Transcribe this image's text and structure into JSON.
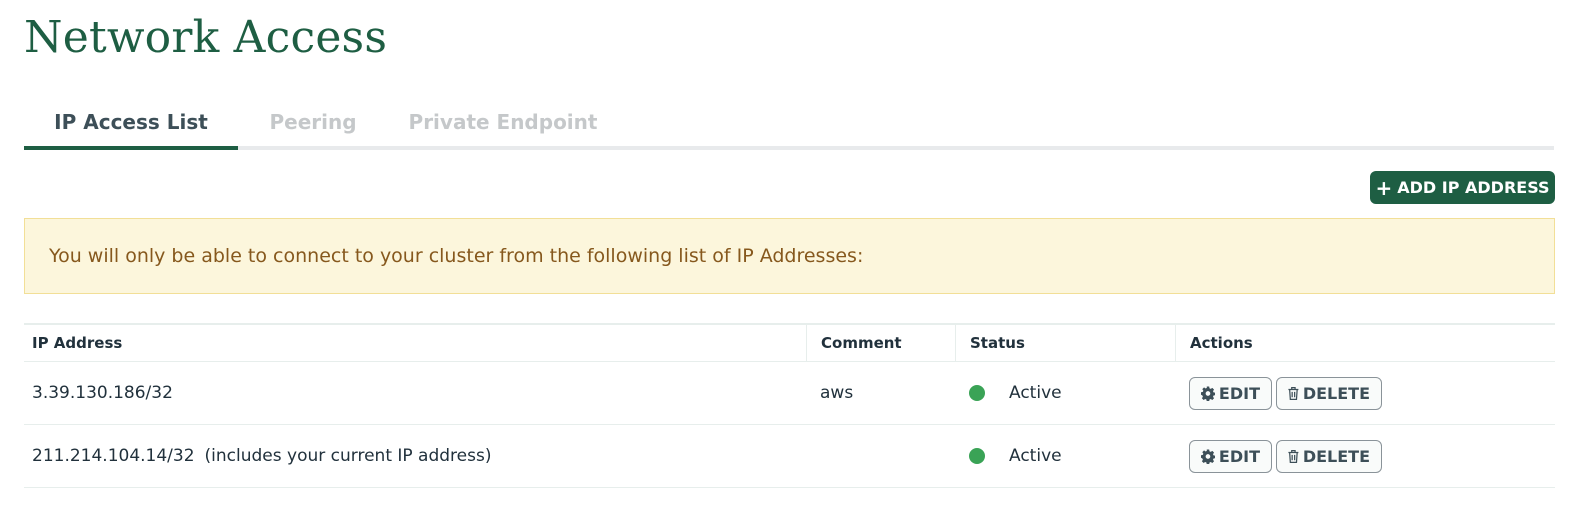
{
  "page": {
    "title": "Network Access"
  },
  "tabs": [
    {
      "label": "IP Access List",
      "active": true
    },
    {
      "label": "Peering",
      "active": false
    },
    {
      "label": "Private Endpoint",
      "active": false
    }
  ],
  "toolbar": {
    "add_label": "ADD IP ADDRESS",
    "add_icon": "plus-icon"
  },
  "banner": {
    "text": "You will only be able to connect to your cluster from the following list of IP Addresses:"
  },
  "table": {
    "headers": [
      "IP Address",
      "Comment",
      "Status",
      "Actions"
    ],
    "rows": [
      {
        "ip": "3.39.130.186/32",
        "note": "",
        "comment": "aws",
        "status": "Active",
        "edit_label": "EDIT",
        "delete_label": "DELETE"
      },
      {
        "ip": "211.214.104.14/32",
        "note": "(includes your current IP address)",
        "comment": "",
        "status": "Active",
        "edit_label": "EDIT",
        "delete_label": "DELETE"
      }
    ]
  },
  "colors": {
    "brand": "#1e5e43",
    "active_status": "#3aa356",
    "banner_bg": "#fcf6dc",
    "banner_text": "#86581d"
  }
}
